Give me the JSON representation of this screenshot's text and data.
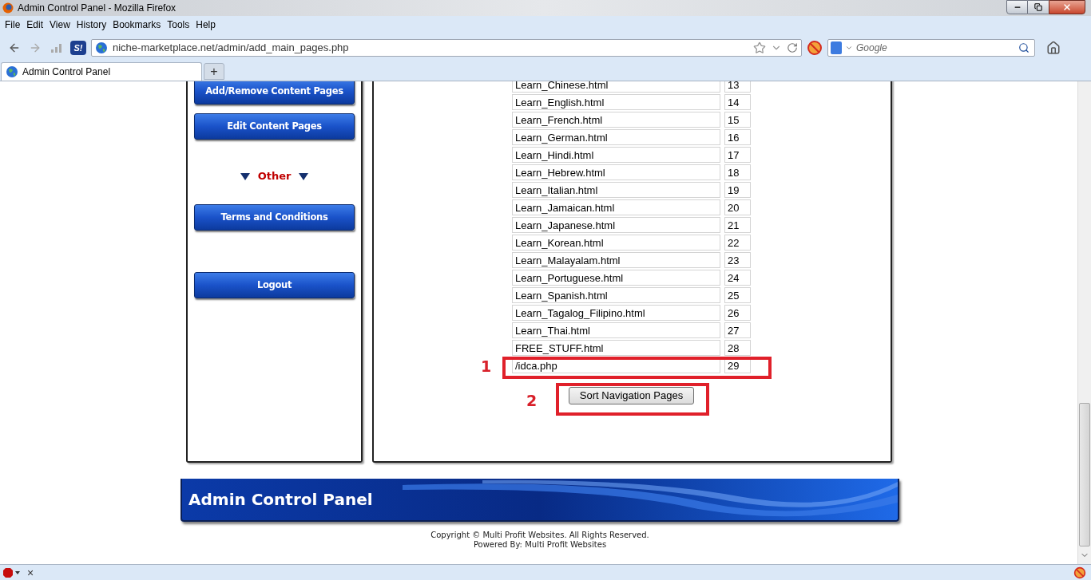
{
  "window": {
    "title": "Admin Control Panel - Mozilla Firefox"
  },
  "menu": [
    "File",
    "Edit",
    "View",
    "History",
    "Bookmarks",
    "Tools",
    "Help"
  ],
  "toolbar": {
    "addon_badge": "S!",
    "url": "niche-marketplace.net/admin/add_main_pages.php",
    "search_placeholder": "Google"
  },
  "tabs": [
    {
      "title": "Admin Control Panel",
      "selected": true
    }
  ],
  "new_tab": "+",
  "sidebar": {
    "items": [
      {
        "kind": "button",
        "label": "Add/Remove Content Pages"
      },
      {
        "kind": "button",
        "label": "Edit Content Pages"
      },
      {
        "kind": "heading",
        "label": "Other"
      },
      {
        "kind": "button",
        "label": "Terms and Conditions"
      },
      {
        "kind": "button",
        "label": "Logout"
      }
    ]
  },
  "pages": [
    {
      "name": "Learn_Chinese.html",
      "order": "13"
    },
    {
      "name": "Learn_English.html",
      "order": "14"
    },
    {
      "name": "Learn_French.html",
      "order": "15"
    },
    {
      "name": "Learn_German.html",
      "order": "16"
    },
    {
      "name": "Learn_Hindi.html",
      "order": "17"
    },
    {
      "name": "Learn_Hebrew.html",
      "order": "18"
    },
    {
      "name": "Learn_Italian.html",
      "order": "19"
    },
    {
      "name": "Learn_Jamaican.html",
      "order": "20"
    },
    {
      "name": "Learn_Japanese.html",
      "order": "21"
    },
    {
      "name": "Learn_Korean.html",
      "order": "22"
    },
    {
      "name": "Learn_Malayalam.html",
      "order": "23"
    },
    {
      "name": "Learn_Portuguese.html",
      "order": "24"
    },
    {
      "name": "Learn_Spanish.html",
      "order": "25"
    },
    {
      "name": "Learn_Tagalog_Filipino.html",
      "order": "26"
    },
    {
      "name": "Learn_Thai.html",
      "order": "27"
    },
    {
      "name": "FREE_STUFF.html",
      "order": "28"
    },
    {
      "name": "/idca.php",
      "order": "29"
    }
  ],
  "submit_button": "Sort Navigation Pages",
  "annotations": [
    {
      "label": "1"
    },
    {
      "label": "2"
    }
  ],
  "footer": {
    "banner_title": "Admin Control Panel",
    "copyright": "Copyright © Multi Profit Websites. All Rights Reserved.",
    "powered_by": "Powered By: Multi Profit Websites"
  },
  "status_bar": {
    "close": "×"
  }
}
